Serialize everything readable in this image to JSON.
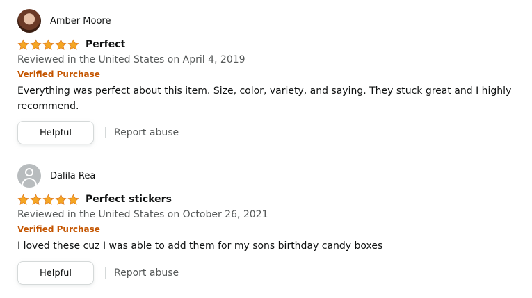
{
  "colors": {
    "star": "#f5a623",
    "verified": "#c45500",
    "secondary_text": "#565959",
    "primary_text": "#0f1111"
  },
  "reviews": [
    {
      "reviewer": "Amber Moore",
      "avatar_icon": "user-photo-avatar",
      "rating": 5,
      "title": "Perfect",
      "date": "Reviewed in the United States on April 4, 2019",
      "badge": "Verified Purchase",
      "body": "Everything was perfect about this item. Size, color, variety, and saying. They stuck great and I highly recommend.",
      "helpful_label": "Helpful",
      "report_label": "Report abuse"
    },
    {
      "reviewer": "Dalila Rea",
      "avatar_icon": "default-user-avatar-icon",
      "rating": 5,
      "title": "Perfect stickers",
      "date": "Reviewed in the United States on October 26, 2021",
      "badge": "Verified Purchase",
      "body": "I loved these cuz I was able to add them for my sons birthday candy boxes",
      "helpful_label": "Helpful",
      "report_label": "Report abuse"
    }
  ]
}
